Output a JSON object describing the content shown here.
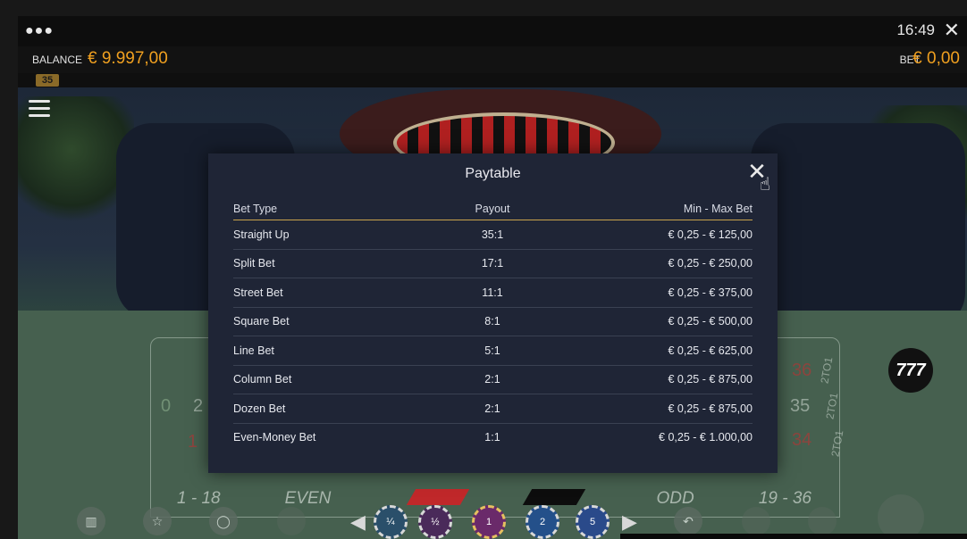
{
  "topbar": {
    "time": "16:49",
    "close_icon": "close-icon"
  },
  "balance": {
    "label": "BALANCE",
    "value": "€ 9.997,00"
  },
  "bet": {
    "label": "BET",
    "value": "€ 0,00"
  },
  "badge": "35",
  "table": {
    "bottom_labels": [
      "1 - 18",
      "EVEN",
      "ODD",
      "19 - 36"
    ],
    "zero": "0",
    "column_labels": [
      "2TO1",
      "2TO1",
      "2TO1"
    ],
    "visible_numbers": [
      "2",
      "1",
      "35",
      "34",
      "36"
    ]
  },
  "logo_text": "777",
  "chips": [
    "¼",
    "½",
    "1",
    "2",
    "5"
  ],
  "modal": {
    "title": "Paytable",
    "headers": {
      "bet_type": "Bet Type",
      "payout": "Payout",
      "min_max": "Min - Max Bet"
    },
    "rows": [
      {
        "bet_type": "Straight Up",
        "payout": "35:1",
        "min_max": "€ 0,25 - € 125,00"
      },
      {
        "bet_type": "Split Bet",
        "payout": "17:1",
        "min_max": "€ 0,25 - € 250,00"
      },
      {
        "bet_type": "Street Bet",
        "payout": "11:1",
        "min_max": "€ 0,25 - € 375,00"
      },
      {
        "bet_type": "Square Bet",
        "payout": "8:1",
        "min_max": "€ 0,25 - € 500,00"
      },
      {
        "bet_type": "Line Bet",
        "payout": "5:1",
        "min_max": "€ 0,25 - € 625,00"
      },
      {
        "bet_type": "Column Bet",
        "payout": "2:1",
        "min_max": "€ 0,25 - € 875,00"
      },
      {
        "bet_type": "Dozen Bet",
        "payout": "2:1",
        "min_max": "€ 0,25 - € 875,00"
      },
      {
        "bet_type": "Even-Money Bet",
        "payout": "1:1",
        "min_max": "€ 0,25 - € 1.000,00"
      }
    ]
  },
  "colors": {
    "accent": "#f0a020",
    "modal_bg": "#1f2536",
    "header_rule": "#c9a34c"
  }
}
